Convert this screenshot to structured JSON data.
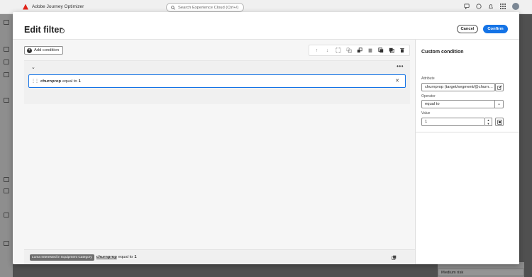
{
  "app": {
    "name": "Adobe Journey Optimizer"
  },
  "search": {
    "placeholder": "Search Experience Cloud (Ctrl+/)"
  },
  "background": {
    "visible_value": "Medium risk"
  },
  "dialog": {
    "title": "Edit filter",
    "cancel_label": "Cancel",
    "confirm_label": "Confirm",
    "add_condition_label": "Add condition",
    "toolbar_icons": [
      "move-up-icon",
      "move-down-icon",
      "group-icon",
      "ungroup-icon",
      "exclude-icon",
      "copy-icon",
      "duplicate-icon",
      "paste-icon",
      "delete-icon"
    ],
    "condition": {
      "attribute": "churnprop",
      "operator": "equal to",
      "value": "1"
    },
    "summary": {
      "tag": "Luma Interested in Equipment Category",
      "attribute": "churnprop",
      "operator": "equal to",
      "value": "1"
    },
    "panel": {
      "title": "Custom condition",
      "attribute_label": "Attribute",
      "attribute_value": "churnprop (target/segment/@churn…",
      "operator_label": "Operator",
      "operator_value": "equal to",
      "value_label": "Value",
      "value_value": "1"
    }
  },
  "colors": {
    "accent": "#1473e6",
    "brand": "#e1251b"
  }
}
